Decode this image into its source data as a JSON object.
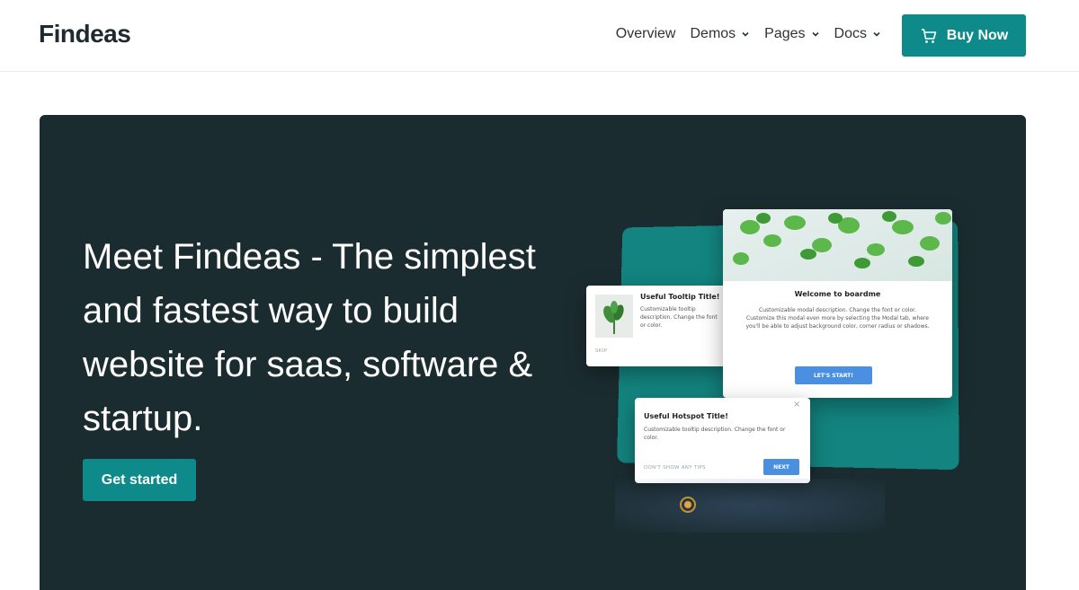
{
  "header": {
    "brand": "Findeas",
    "nav": [
      {
        "label": "Overview",
        "has_dropdown": false
      },
      {
        "label": "Demos",
        "has_dropdown": true
      },
      {
        "label": "Pages",
        "has_dropdown": true
      },
      {
        "label": "Docs",
        "has_dropdown": true
      }
    ],
    "buy_label": "Buy Now"
  },
  "hero": {
    "title": "Meet Findeas - The simplest and fastest way to build website for saas, software & startup.",
    "cta_label": "Get started"
  },
  "illustration": {
    "tooltip": {
      "title": "Useful Tooltip Title!",
      "text": "Customizable tooltip description. Change the font or color.",
      "skip": "SKIP"
    },
    "modal": {
      "title": "Welcome to boardme",
      "text": "Customizable modal description. Change the font or color. Customize this modal even more by selecting the Modal tab, where you'll be able to adjust background color, corner radius or shadows.",
      "button": "LET'S START!"
    },
    "hotspot": {
      "title": "Useful Hotspot Title!",
      "text": "Customizable tooltip description. Change the font or color.",
      "dismiss": "DON'T SHOW ANY TIPS",
      "next": "NEXT",
      "close": "×"
    }
  },
  "colors": {
    "accent": "#0e8a8a",
    "hero_bg": "#1b2c30",
    "panel": "#13847f",
    "button_blue": "#4a8fe0"
  }
}
